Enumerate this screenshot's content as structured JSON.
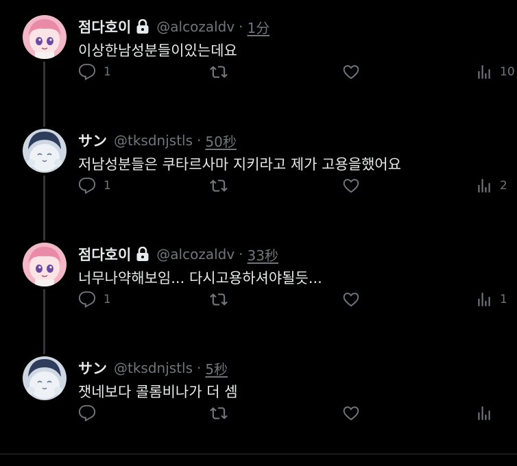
{
  "tweets": [
    {
      "name": "점다호이",
      "locked": true,
      "handle": "@alcozaldv",
      "separator": "·",
      "time": "1分",
      "text": "이상한남성분들이있는데요",
      "reply_count": "1",
      "retweet_count": "",
      "like_count": "",
      "view_count": "10"
    },
    {
      "name": "サン",
      "locked": false,
      "handle": "@tksdnjstls",
      "separator": "·",
      "time": "50秒",
      "text": "저남성분들은 쿠타르사마 지키라고 제가 고용을했어요",
      "reply_count": "1",
      "retweet_count": "",
      "like_count": "",
      "view_count": "2"
    },
    {
      "name": "점다호이",
      "locked": true,
      "handle": "@alcozaldv",
      "separator": "·",
      "time": "33秒",
      "text": "너무나약해보임... 다시고용하셔야될듯...",
      "reply_count": "1",
      "retweet_count": "",
      "like_count": "",
      "view_count": "1"
    },
    {
      "name": "サン",
      "locked": false,
      "handle": "@tksdnjstls",
      "separator": "·",
      "time": "5秒",
      "text": "잿네보다 콜롬비나가 더 셈",
      "reply_count": "",
      "retweet_count": "",
      "like_count": "",
      "view_count": ""
    }
  ],
  "colors": {
    "background": "#000000",
    "text": "#e7e9ea",
    "muted": "#71767b",
    "thread_line": "#333639"
  }
}
